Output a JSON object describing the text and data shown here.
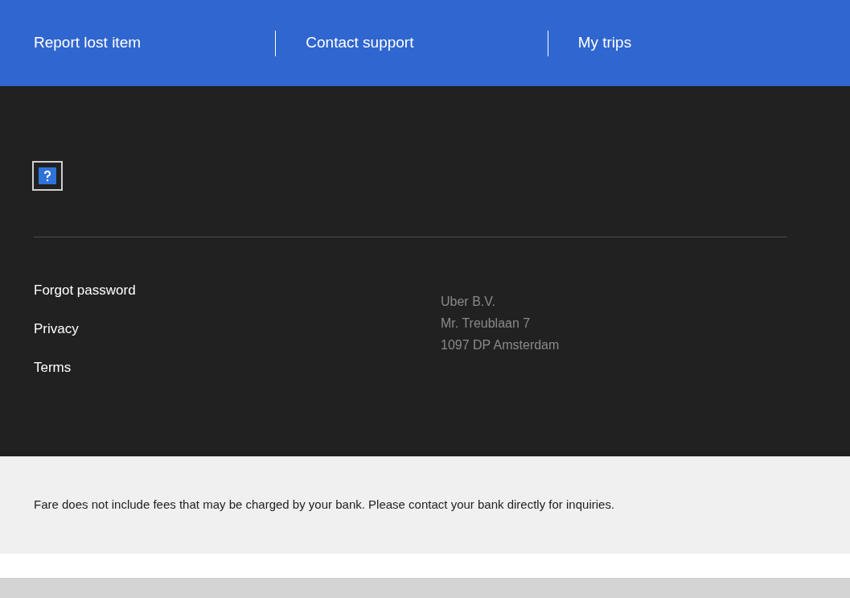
{
  "nav": [
    "Report lost item",
    "Contact support",
    "My trips"
  ],
  "footer_links": [
    "Forgot password",
    "Privacy",
    "Terms"
  ],
  "address": [
    "Uber B.V.",
    "Mr. Treublaan 7",
    "1097 DP Amsterdam"
  ],
  "notice": "Fare does not include fees that may be charged by your bank. Please contact your bank directly for inquiries."
}
